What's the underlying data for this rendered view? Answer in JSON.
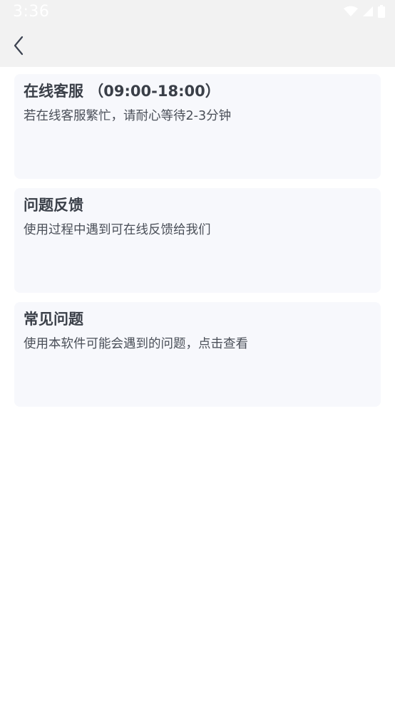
{
  "status_bar": {
    "time": "3:36",
    "icons": [
      "wifi-icon",
      "cell-signal-icon",
      "battery-icon"
    ]
  },
  "app_bar": {
    "back_icon": "chevron-left-icon"
  },
  "cards": [
    {
      "title": "在线客服 （09:00-18:00）",
      "description": "若在线客服繁忙，请耐心等待2-3分钟"
    },
    {
      "title": "问题反馈",
      "description": "使用过程中遇到可在线反馈给我们"
    },
    {
      "title": "常见问题",
      "description": "使用本软件可能会遇到的问题，点击查看"
    }
  ],
  "colors": {
    "status_bar_bg": "#f2f2f2",
    "app_bar_bg": "#f2f2f2",
    "card_bg": "#f7f8fc",
    "text_primary": "#3a3f48",
    "text_secondary": "#4a4f58"
  }
}
